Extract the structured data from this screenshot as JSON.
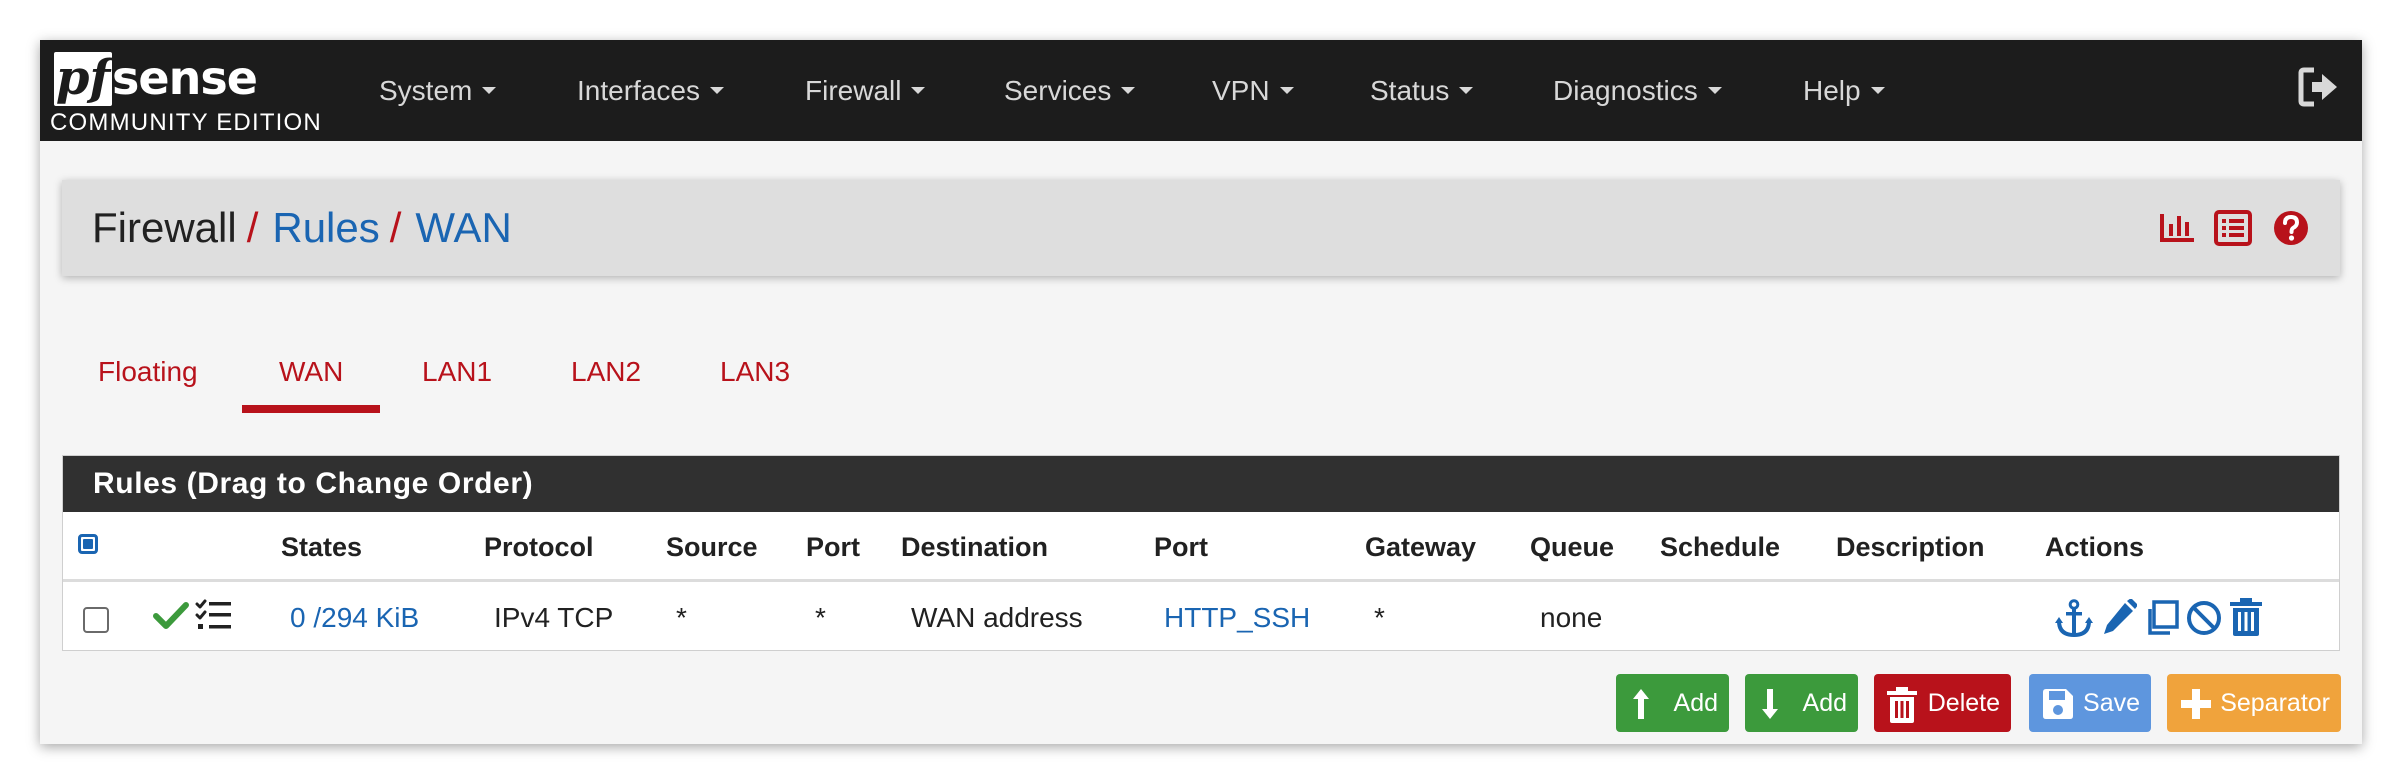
{
  "app": {
    "logo_text": "pfsense",
    "edition": "COMMUNITY EDITION"
  },
  "nav": {
    "items": [
      {
        "label": "System"
      },
      {
        "label": "Interfaces"
      },
      {
        "label": "Firewall"
      },
      {
        "label": "Services"
      },
      {
        "label": "VPN"
      },
      {
        "label": "Status"
      },
      {
        "label": "Diagnostics"
      },
      {
        "label": "Help"
      }
    ],
    "logout_icon": "sign-out-icon"
  },
  "breadcrumb": {
    "root": "Firewall",
    "sep": "/",
    "items": [
      "Rules",
      "WAN"
    ],
    "icons": [
      "bar-chart-icon",
      "list-icon",
      "help-icon"
    ]
  },
  "tabs": {
    "items": [
      "Floating",
      "WAN",
      "LAN1",
      "LAN2",
      "LAN3"
    ],
    "active": "WAN"
  },
  "rules": {
    "title": "Rules (Drag to Change Order)",
    "columns": [
      "States",
      "Protocol",
      "Source",
      "Port",
      "Destination",
      "Port",
      "Gateway",
      "Queue",
      "Schedule",
      "Description",
      "Actions"
    ],
    "row": {
      "states": "0 /294 KiB",
      "protocol": "IPv4 TCP",
      "source": "*",
      "source_port": "*",
      "destination": "WAN address",
      "dest_port": "HTTP_SSH",
      "gateway": "*",
      "queue": "none",
      "schedule": "",
      "description": "",
      "status_icons": [
        "check-icon",
        "tasks-icon"
      ],
      "action_icons": [
        "anchor-icon",
        "pencil-icon",
        "copy-icon",
        "ban-icon",
        "trash-icon"
      ]
    }
  },
  "buttons": {
    "add_top": "Add",
    "add_bottom": "Add",
    "delete": "Delete",
    "save": "Save",
    "separator": "Separator"
  },
  "colors": {
    "navbar": "#1c1c1c",
    "brand_red": "#b8121b",
    "link_blue": "#1a65b2",
    "success": "#3c9a3c",
    "danger": "#b8121b",
    "primary": "#5e96de",
    "warning": "#f0a33c"
  }
}
